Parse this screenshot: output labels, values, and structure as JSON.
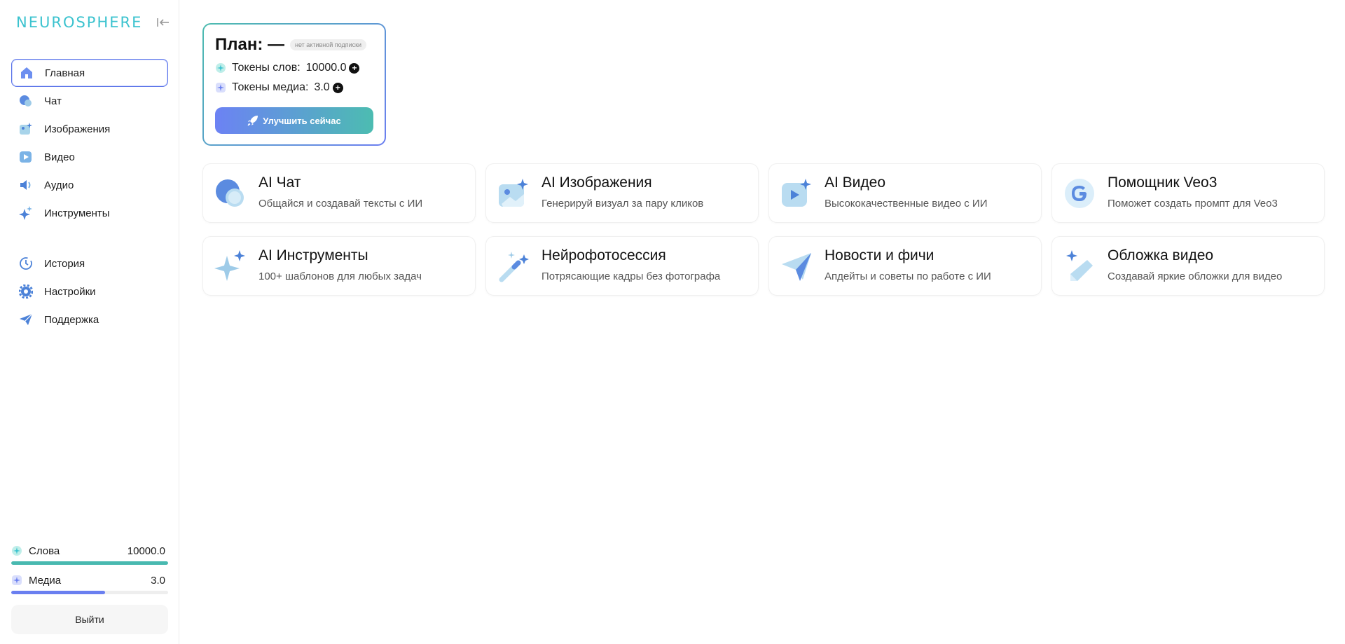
{
  "brand": {
    "name": "NEUROSPHERE"
  },
  "nav": {
    "main": [
      {
        "id": "home",
        "label": "Главная",
        "icon": "home-icon",
        "active": true
      },
      {
        "id": "chat",
        "label": "Чат",
        "icon": "chat-icon"
      },
      {
        "id": "images",
        "label": "Изображения",
        "icon": "image-icon"
      },
      {
        "id": "video",
        "label": "Видео",
        "icon": "video-icon"
      },
      {
        "id": "audio",
        "label": "Аудио",
        "icon": "speaker-icon"
      },
      {
        "id": "tools",
        "label": "Инструменты",
        "icon": "sparkle-icon"
      }
    ],
    "secondary": [
      {
        "id": "history",
        "label": "История",
        "icon": "clock-icon"
      },
      {
        "id": "settings",
        "label": "Настройки",
        "icon": "gear-icon"
      },
      {
        "id": "support",
        "label": "Поддержка",
        "icon": "send-icon"
      }
    ]
  },
  "usage": {
    "words": {
      "label": "Слова",
      "value": "10000.0",
      "fill_fraction": 1.0
    },
    "media": {
      "label": "Медиа",
      "value": "3.0",
      "fill_fraction": 0.6
    }
  },
  "logout_label": "Выйти",
  "plan": {
    "title": "План: —",
    "badge": "нет активной подписки",
    "word_tokens_label": "Токены слов:",
    "word_tokens_value": "10000.0",
    "media_tokens_label": "Токены медиа:",
    "media_tokens_value": "3.0",
    "upgrade_label": "Улучшить сейчас"
  },
  "features": [
    {
      "title": "AI Чат",
      "desc": "Общайся и создавай тексты с ИИ",
      "icon": "chat-bubble-icon"
    },
    {
      "title": "AI Изображения",
      "desc": "Генерируй визуал за пару кликов",
      "icon": "image-sparkle-icon"
    },
    {
      "title": "AI Видео",
      "desc": "Высококачественные видео с ИИ",
      "icon": "video-sparkle-icon"
    },
    {
      "title": "Помощник Veo3",
      "desc": "Поможет создать промпт для Veo3",
      "icon": "google-icon"
    },
    {
      "title": "AI Инструменты",
      "desc": "100+ шаблонов для любых задач",
      "icon": "sparkles-icon"
    },
    {
      "title": "Нейрофотосессия",
      "desc": "Потрясающие кадры без фотографа",
      "icon": "magic-wand-icon"
    },
    {
      "title": "Новости и фичи",
      "desc": "Апдейты и советы по работе с ИИ",
      "icon": "paper-plane-icon"
    },
    {
      "title": "Обложка видео",
      "desc": "Создавай яркие обложки для видео",
      "icon": "pencil-sparkle-icon"
    }
  ],
  "colors": {
    "accent_teal": "#48b9b0",
    "accent_blue": "#6a7ff0",
    "brand": "#3cc3cf"
  }
}
